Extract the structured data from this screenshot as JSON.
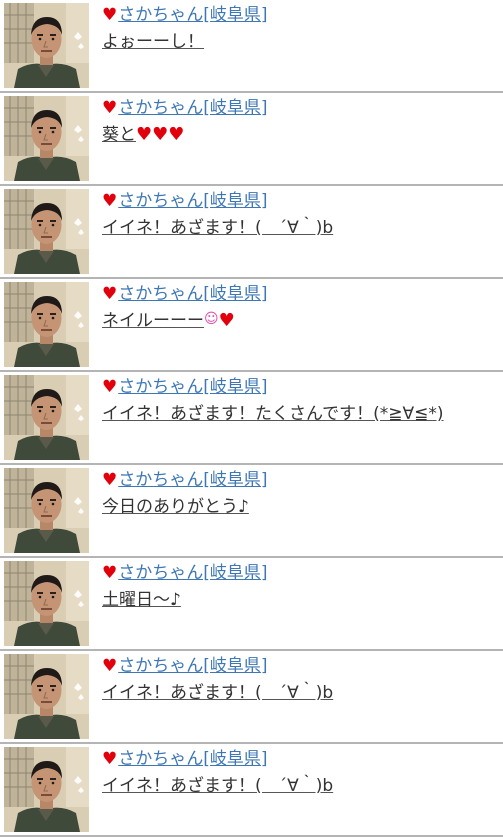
{
  "feed": {
    "items": [
      {
        "author": "さかちゃん[岐阜県]",
        "comment": "よぉーーし！",
        "emojis": []
      },
      {
        "author": "さかちゃん[岐阜県]",
        "comment": "葵と",
        "emojis": [
          "heart",
          "heart",
          "heart"
        ]
      },
      {
        "author": "さかちゃん[岐阜県]",
        "comment": "イイネ！あざます！(　´∀｀)b",
        "emojis": []
      },
      {
        "author": "さかちゃん[岐阜県]",
        "comment": "ネイルーーー",
        "emojis": [
          "smile",
          "heart"
        ]
      },
      {
        "author": "さかちゃん[岐阜県]",
        "comment": "イイネ！あざます！たくさんです！(*≧∀≦*)",
        "emojis": []
      },
      {
        "author": "さかちゃん[岐阜県]",
        "comment": "今日のありがとう♪",
        "emojis": []
      },
      {
        "author": "さかちゃん[岐阜県]",
        "comment": "土曜日～♪",
        "emojis": []
      },
      {
        "author": "さかちゃん[岐阜県]",
        "comment": "イイネ！あざます！(　´∀｀)b",
        "emojis": []
      },
      {
        "author": "さかちゃん[岐阜県]",
        "comment": "イイネ！あざます！(　´∀｀)b",
        "emojis": []
      }
    ]
  },
  "colors": {
    "author_link": "#3e77b6",
    "heart": "#e1000c",
    "separator": "#b4b4b4"
  }
}
